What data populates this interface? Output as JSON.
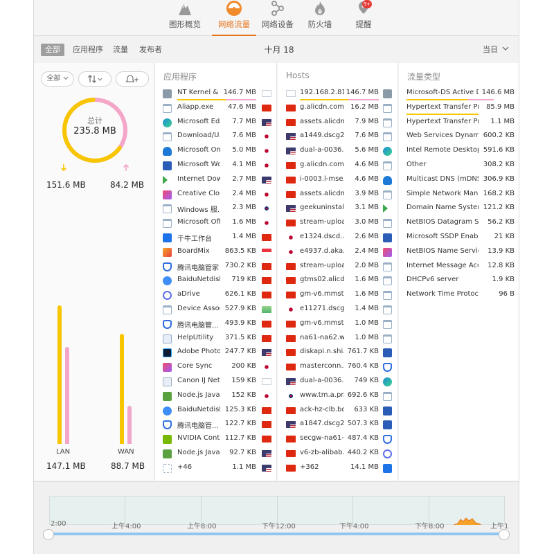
{
  "toolbar": {
    "tabs": [
      {
        "label": "图形概览",
        "icon": "mountain-icon"
      },
      {
        "label": "网络流量",
        "icon": "traffic-gauge-icon"
      },
      {
        "label": "网络设备",
        "icon": "devices-network-icon"
      },
      {
        "label": "防火墙",
        "icon": "flame-icon"
      },
      {
        "label": "提醒",
        "icon": "alert-bell-icon",
        "badge": "9+"
      }
    ],
    "active_tab": "网络流量"
  },
  "filters": {
    "items": [
      "全部",
      "应用程序",
      "流量",
      "发布者"
    ],
    "selected": "全部",
    "date": "十月 18",
    "range": "当日"
  },
  "left": {
    "controls": {
      "filter": "全部",
      "sort_icon": "sort-arrows-icon",
      "alert_icon": "add-alert-bell-icon"
    },
    "total_label": "总计",
    "total_value": "235.8 MB",
    "download": "151.6 MB",
    "upload": "84.2 MB",
    "lan_label": "LAN",
    "lan_value": "147.1 MB",
    "wan_label": "WAN",
    "wan_value": "88.7 MB"
  },
  "colors": {
    "download": "#f7c600",
    "upload": "#f4a6c8",
    "accent": "#e8761f"
  },
  "apps": {
    "header": "应用程序",
    "rows": [
      {
        "name": "NT Kernel & ...",
        "size": "146.7 MB",
        "icon": "gear-arrows-icon",
        "flag": "none"
      },
      {
        "name": "Aliapp.exe",
        "size": "47.6 MB",
        "icon": "window-app-icon",
        "flag": "cn"
      },
      {
        "name": "Microsoft Edge",
        "size": "7.7 MB",
        "icon": "edge-icon",
        "flag": "us"
      },
      {
        "name": "Download/U...",
        "size": "7.6 MB",
        "icon": "window-app-icon",
        "flag": "jp"
      },
      {
        "name": "Microsoft On...",
        "size": "5.0 MB",
        "icon": "onedrive-icon",
        "flag": "jp"
      },
      {
        "name": "Microsoft Wo...",
        "size": "4.1 MB",
        "icon": "word-icon",
        "flag": "jp"
      },
      {
        "name": "Internet Dow...",
        "size": "2.7 MB",
        "icon": "idm-arrows-icon",
        "flag": "us"
      },
      {
        "name": "Creative Cloud",
        "size": "2.4 MB",
        "icon": "creative-cloud-icon",
        "flag": "jp"
      },
      {
        "name": "Windows 服...",
        "size": "2.3 MB",
        "icon": "window-app-icon",
        "flag": "kr"
      },
      {
        "name": "Microsoft Off...",
        "size": "1.6 MB",
        "icon": "window-app-icon",
        "flag": "jp"
      },
      {
        "name": "千牛工作台",
        "size": "1.4 MB",
        "icon": "qianniu-icon",
        "flag": "cn"
      },
      {
        "name": "BoardMix",
        "size": "863.5 KB",
        "icon": "boardmix-icon",
        "flag": "sg"
      },
      {
        "name": "腾讯电脑管家",
        "size": "730.2 KB",
        "icon": "shield-check-icon",
        "flag": "cn"
      },
      {
        "name": "BaiduNetdisk",
        "size": "719 KB",
        "icon": "baidu-cloud-icon",
        "flag": "cn"
      },
      {
        "name": "aDrive",
        "size": "626.1 KB",
        "icon": "adrive-icon",
        "flag": "cn"
      },
      {
        "name": "Device Assoc...",
        "size": "527.9 KB",
        "icon": "window-app-icon",
        "flag": "gl"
      },
      {
        "name": "腾讯电脑管...",
        "size": "493.9 KB",
        "icon": "shield-check-icon",
        "flag": "cn"
      },
      {
        "name": "HelpUtility",
        "size": "371.5 KB",
        "icon": "help-utility-icon",
        "flag": "cn"
      },
      {
        "name": "Adobe Photo...",
        "size": "247.7 KB",
        "icon": "photoshop-icon",
        "flag": "us"
      },
      {
        "name": "Core Sync",
        "size": "200 KB",
        "icon": "creative-cloud-icon",
        "flag": "jp"
      },
      {
        "name": "Canon IJ Net...",
        "size": "159 KB",
        "icon": "canon-icon",
        "flag": "none"
      },
      {
        "name": "Node.js Java...",
        "size": "152 KB",
        "icon": "nodejs-icon",
        "flag": "jp"
      },
      {
        "name": "BaiduNetdisk...",
        "size": "125.3 KB",
        "icon": "baidu-cloud-icon",
        "flag": "cn"
      },
      {
        "name": "腾讯电脑管...",
        "size": "122.7 KB",
        "icon": "shield-check-icon",
        "flag": "cn"
      },
      {
        "name": "NVIDIA Cont...",
        "size": "112.7 KB",
        "icon": "nvidia-icon",
        "flag": "cn"
      },
      {
        "name": "Node.js Java...",
        "size": "92.7 KB",
        "icon": "nodejs-icon",
        "flag": "us"
      },
      {
        "name": "+46",
        "size": "1.1 MB",
        "icon": "grid-apps-icon",
        "flag": "us"
      }
    ]
  },
  "hosts": {
    "header": "Hosts",
    "rows": [
      {
        "name": "192.168.2.81",
        "size": "146.7 MB",
        "flag": "none",
        "app": "gear-arrows-icon"
      },
      {
        "name": "g.alicdn.com...",
        "size": "16.2 MB",
        "flag": "cn",
        "app": "window-app-icon"
      },
      {
        "name": "assets.alicdn...",
        "size": "7.9 MB",
        "flag": "cn",
        "app": "window-app-icon"
      },
      {
        "name": "a1449.dscg2...",
        "size": "7.6 MB",
        "flag": "us",
        "app": "window-app-icon"
      },
      {
        "name": "dual-a-0036....",
        "size": "5.6 MB",
        "flag": "us",
        "app": "edge-icon"
      },
      {
        "name": "g.alicdn.com...",
        "size": "4.6 MB",
        "flag": "cn",
        "app": "window-app-icon"
      },
      {
        "name": "i-0003.l-mse...",
        "size": "4.6 MB",
        "flag": "cn",
        "app": "onedrive-icon"
      },
      {
        "name": "assets.alicdn...",
        "size": "3.9 MB",
        "flag": "cn",
        "app": "window-app-icon"
      },
      {
        "name": "geekuninstall...",
        "size": "3.1 MB",
        "flag": "us",
        "app": "idm-arrows-icon"
      },
      {
        "name": "stream-uploa...",
        "size": "3.0 MB",
        "flag": "cn",
        "app": "window-app-icon"
      },
      {
        "name": "e1324.dscd....",
        "size": "2.6 MB",
        "flag": "jp",
        "app": "word-icon"
      },
      {
        "name": "e4937.d.aka...",
        "size": "2.4 MB",
        "flag": "jp",
        "app": "creative-cloud-icon"
      },
      {
        "name": "stream-uploa...",
        "size": "2.0 MB",
        "flag": "cn",
        "app": "window-app-icon"
      },
      {
        "name": "gtms02.alicd...",
        "size": "1.6 MB",
        "flag": "cn",
        "app": "window-app-icon"
      },
      {
        "name": "gm-v6.mmst...",
        "size": "1.6 MB",
        "flag": "cn",
        "app": "window-app-icon"
      },
      {
        "name": "e11271.dscg...",
        "size": "1.4 MB",
        "flag": "jp",
        "app": "window-app-icon"
      },
      {
        "name": "gm-v6.mmst...",
        "size": "1.0 MB",
        "flag": "cn",
        "app": "window-app-icon"
      },
      {
        "name": "na61-na62.w...",
        "size": "1.0 MB",
        "flag": "cn",
        "app": "window-app-icon"
      },
      {
        "name": "diskapi.n.shi...",
        "size": "761.7 KB",
        "flag": "cn",
        "app": "word-icon"
      },
      {
        "name": "masterconn....",
        "size": "760.4 KB",
        "flag": "cn",
        "app": "shield-check-icon"
      },
      {
        "name": "dual-a-0036....",
        "size": "749 KB",
        "flag": "us",
        "app": "edge-icon"
      },
      {
        "name": "www.tm.a.pr...",
        "size": "692.6 KB",
        "flag": "kr",
        "app": "window-app-icon"
      },
      {
        "name": "ack-hz-clb.bo...",
        "size": "633 KB",
        "flag": "cn",
        "app": "word-icon"
      },
      {
        "name": "a1847.dscg2...",
        "size": "507.3 KB",
        "flag": "us",
        "app": "word-icon"
      },
      {
        "name": "secgw-na61-...",
        "size": "487.4 KB",
        "flag": "cn",
        "app": "shield-check-icon"
      },
      {
        "name": "v6-zb-alibab...",
        "size": "440.2 KB",
        "flag": "cn",
        "app": "adrive-icon"
      },
      {
        "name": "+362",
        "size": "14.1 MB",
        "flag": "cn",
        "app": "qianniu-icon"
      }
    ]
  },
  "types": {
    "header": "流量类型",
    "rows": [
      {
        "name": "Microsoft-DS Active Di...",
        "size": "146.6 MB"
      },
      {
        "name": "Hypertext Transfer Pro...",
        "size": "85.9 MB"
      },
      {
        "name": "Hypertext Transfer Pro...",
        "size": "1.1 MB"
      },
      {
        "name": "Web Services Dynamic...",
        "size": "600.2 KB"
      },
      {
        "name": "Intel Remote Desktop ...",
        "size": "591.6 KB"
      },
      {
        "name": "Other",
        "size": "308.2 KB"
      },
      {
        "name": "Multicast DNS (mDNS)",
        "size": "306.9 KB"
      },
      {
        "name": "Simple Network Mana...",
        "size": "168.2 KB"
      },
      {
        "name": "Domain Name System...",
        "size": "121.2 KB"
      },
      {
        "name": "NetBIOS Datagram Ser...",
        "size": "56.2 KB"
      },
      {
        "name": "Microsoft SSDP Enabl...",
        "size": "21 KB"
      },
      {
        "name": "NetBIOS Name Service",
        "size": "13.9 KB"
      },
      {
        "name": "Internet Message Acce...",
        "size": "12.8 KB"
      },
      {
        "name": "DHCPv6 server",
        "size": "1.9 KB"
      },
      {
        "name": "Network Time Protocol...",
        "size": "96 B"
      }
    ]
  },
  "timeline": {
    "ticks": [
      "2:00",
      "上午4:00",
      "上午8:00",
      "下午12:00",
      "下午4:00",
      "下午8:00",
      "上午1"
    ]
  }
}
